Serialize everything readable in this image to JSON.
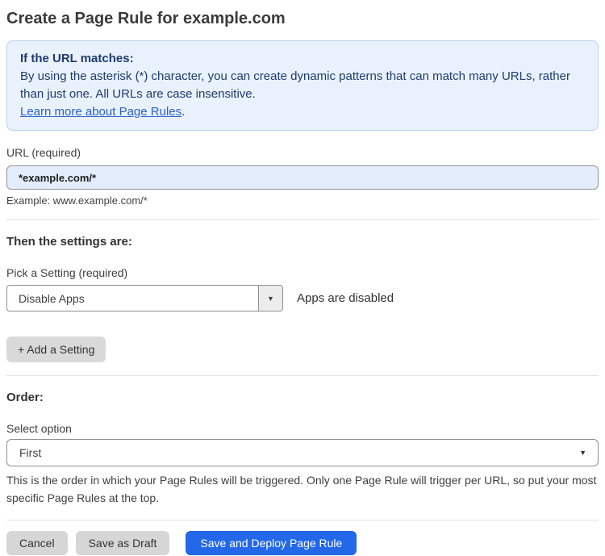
{
  "page": {
    "title": "Create a Page Rule for example.com"
  },
  "info_box": {
    "heading": "If the URL matches:",
    "body": "By using the asterisk (*) character, you can create dynamic patterns that can match many URLs, rather than just one. All URLs are case insensitive.",
    "link_label": "Learn more about Page Rules",
    "link_suffix": "."
  },
  "url_section": {
    "label": "URL (required)",
    "value": "*example.com/*",
    "example": "Example: www.example.com/*"
  },
  "settings_section": {
    "heading": "Then the settings are:",
    "picker_label": "Pick a Setting (required)",
    "selected_setting": "Disable Apps",
    "status_text": "Apps are disabled",
    "add_button_label": "+ Add a Setting"
  },
  "order_section": {
    "heading": "Order:",
    "select_label": "Select option",
    "selected_option": "First",
    "help_text": "This is the order in which your Page Rules will be triggered. Only one Page Rule will trigger per URL, so put your most specific Page Rules at the top."
  },
  "footer": {
    "cancel_label": "Cancel",
    "save_draft_label": "Save as Draft",
    "save_deploy_label": "Save and Deploy Page Rule"
  },
  "icons": {
    "dropdown_caret": "▼"
  },
  "colors": {
    "primary_button": "#2268e8",
    "info_box_bg": "#e9f1fc",
    "info_box_border": "#b7d3f1",
    "info_text": "#1e3c6e",
    "link": "#2b61c6",
    "input_bg": "#e3edfb",
    "gray_button": "#d6d6d6"
  }
}
